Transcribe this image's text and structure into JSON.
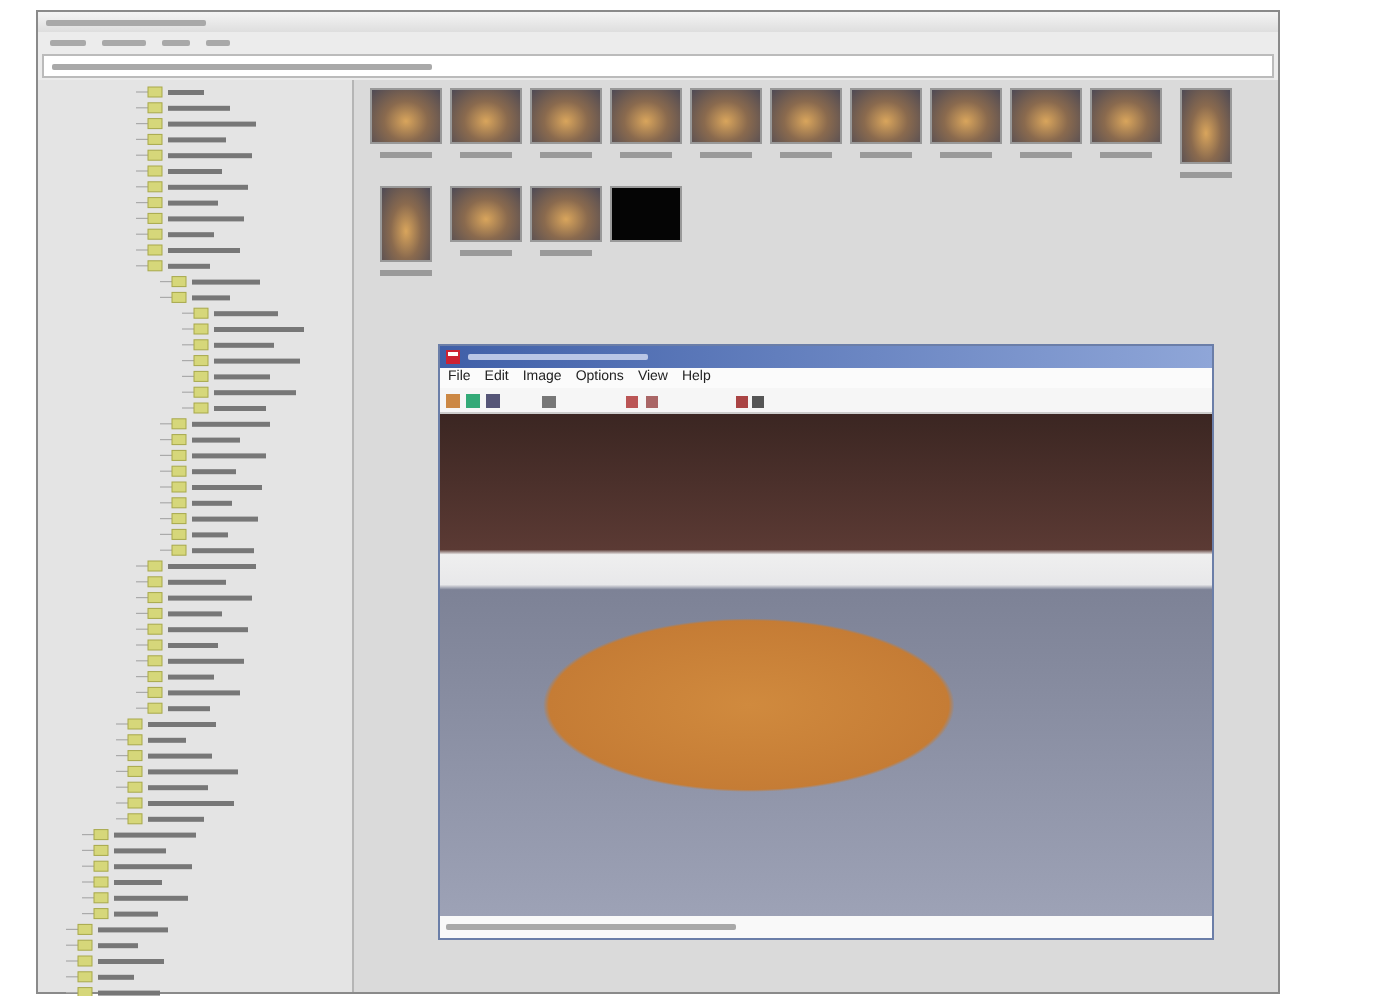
{
  "thumbnails": [
    {
      "kind": "landscape"
    },
    {
      "kind": "landscape"
    },
    {
      "kind": "landscape"
    },
    {
      "kind": "landscape"
    },
    {
      "kind": "landscape"
    },
    {
      "kind": "landscape"
    },
    {
      "kind": "landscape"
    },
    {
      "kind": "landscape"
    },
    {
      "kind": "landscape"
    },
    {
      "kind": "landscape"
    },
    {
      "kind": "portrait"
    },
    {
      "kind": "portrait"
    },
    {
      "kind": "landscape"
    },
    {
      "kind": "landscape"
    },
    {
      "kind": "black"
    }
  ],
  "viewer": {
    "menu": [
      "File",
      "Edit",
      "Image",
      "Options",
      "View",
      "Help"
    ]
  }
}
